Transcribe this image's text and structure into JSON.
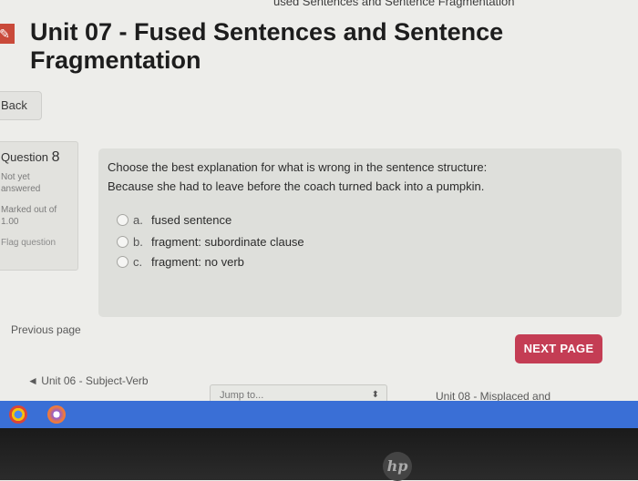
{
  "breadcrumb": "used Sentences and Sentence Fragmentation",
  "page_title": "Unit 07 - Fused Sentences and Sentence Fragmentation",
  "back_label": "Back",
  "question_info": {
    "label": "Question",
    "number": "8",
    "status": "Not yet answered",
    "mark": "Marked out of 1.00",
    "flag": "Flag question"
  },
  "question": {
    "prompt": "Choose the best explanation for what is wrong in the sentence structure:",
    "sentence": "Because she had to leave before the coach turned back into a pumpkin.",
    "answers": [
      {
        "letter": "a.",
        "text": "fused sentence"
      },
      {
        "letter": "b.",
        "text": "fragment: subordinate clause"
      },
      {
        "letter": "c.",
        "text": "fragment: no verb"
      }
    ]
  },
  "nav": {
    "previous_page": "Previous page",
    "next_page": "NEXT PAGE",
    "prev_unit": "◄ Unit 06 - Subject-Verb",
    "jump_to": "Jump to...",
    "next_unit": "Unit 08 - Misplaced and"
  },
  "colors": {
    "accent": "#c43d54",
    "taskbar": "#3a6fd6"
  }
}
